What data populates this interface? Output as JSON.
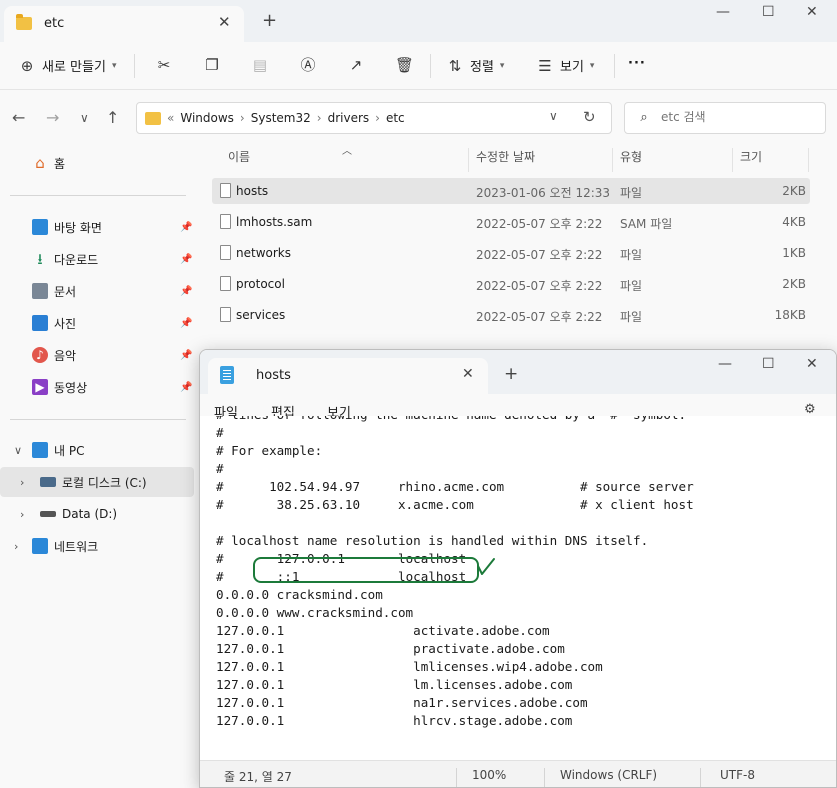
{
  "explorer": {
    "tab_title": "etc",
    "toolbar": {
      "new_label": "새로 만들기",
      "sort_label": "정렬",
      "view_label": "보기",
      "more_label": "···"
    },
    "address": {
      "prefix": "«",
      "crumbs": [
        "Windows",
        "System32",
        "drivers",
        "etc"
      ]
    },
    "search": {
      "placeholder": "etc 검색"
    },
    "sidebar": {
      "home": "홈",
      "quick": [
        "바탕 화면",
        "다운로드",
        "문서",
        "사진",
        "음악",
        "동영상"
      ],
      "pc": "내 PC",
      "local_disk": "로컬 디스크 (C:)",
      "data_disk": "Data (D:)",
      "network": "네트워크"
    },
    "columns": {
      "name": "이름",
      "date": "수정한 날짜",
      "type": "유형",
      "size": "크기"
    },
    "files": [
      {
        "name": "hosts",
        "date": "2023-01-06 오전 12:33",
        "type": "파일",
        "size": "2KB"
      },
      {
        "name": "lmhosts.sam",
        "date": "2022-05-07 오후 2:22",
        "type": "SAM 파일",
        "size": "4KB"
      },
      {
        "name": "networks",
        "date": "2022-05-07 오후 2:22",
        "type": "파일",
        "size": "1KB"
      },
      {
        "name": "protocol",
        "date": "2022-05-07 오후 2:22",
        "type": "파일",
        "size": "2KB"
      },
      {
        "name": "services",
        "date": "2022-05-07 오후 2:22",
        "type": "파일",
        "size": "18KB"
      }
    ]
  },
  "notepad": {
    "tab_title": "hosts",
    "menu": {
      "file": "파일",
      "edit": "편집",
      "view": "보기"
    },
    "content": "# lines or following the machine name denoted by a '#' symbol.\n#\n# For example:\n#\n#      102.54.94.97     rhino.acme.com          # source server\n#       38.25.63.10     x.acme.com              # x client host\n\n# localhost name resolution is handled within DNS itself.\n#\t127.0.0.1       localhost\n#\t::1             localhost\n0.0.0.0 cracksmind.com\n0.0.0.0 www.cracksmind.com\n127.0.0.1                 activate.adobe.com\n127.0.0.1                 practivate.adobe.com\n127.0.0.1                 lmlicenses.wip4.adobe.com\n127.0.0.1                 lm.licenses.adobe.com\n127.0.0.1                 na1r.services.adobe.com\n127.0.0.1                 hlrcv.stage.adobe.com",
    "status": {
      "position": "줄 21, 열 27",
      "zoom": "100%",
      "line_ending": "Windows (CRLF)",
      "encoding": "UTF-8"
    }
  }
}
